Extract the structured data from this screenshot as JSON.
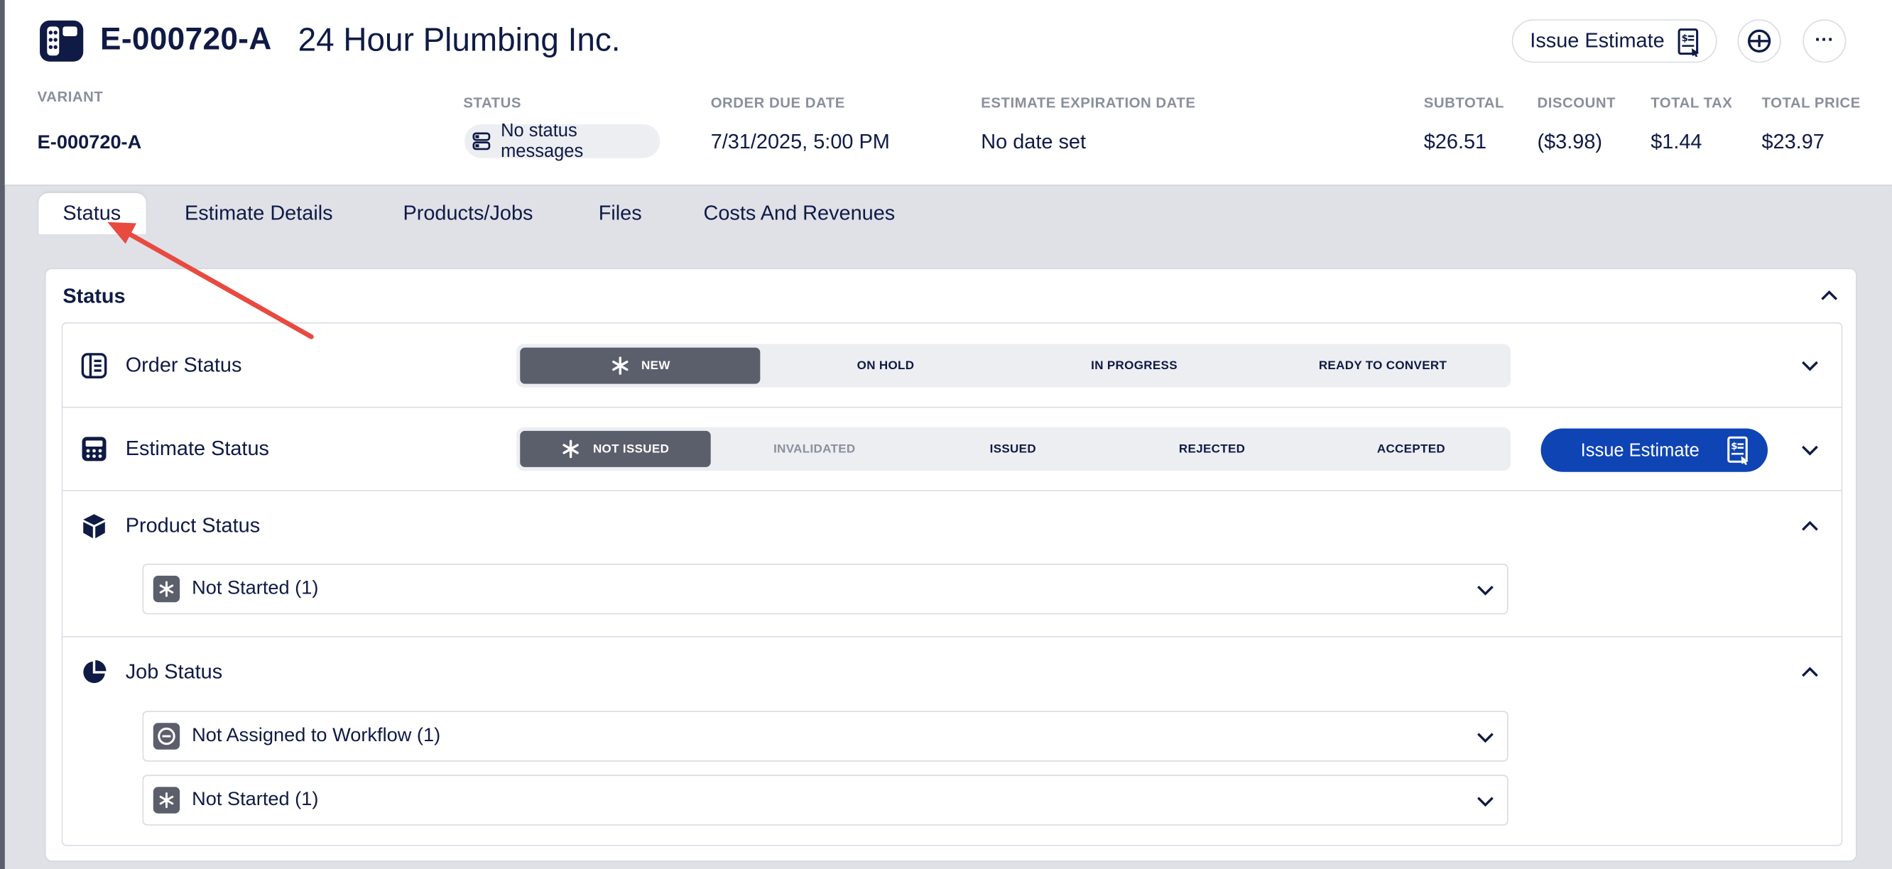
{
  "header": {
    "estimate_id": "E-000720-A",
    "company": "24 Hour Plumbing Inc.",
    "issue_button": "Issue Estimate",
    "more": "···"
  },
  "meta": {
    "variant_label": "VARIANT",
    "variant_value": "E-000720-A",
    "status_label": "STATUS",
    "status_value": "No status messages",
    "due_label": "ORDER DUE DATE",
    "due_value": "7/31/2025, 5:00 PM",
    "exp_label": "ESTIMATE EXPIRATION DATE",
    "exp_value": "No date set",
    "subtotal_label": "SUBTOTAL",
    "subtotal_value": "$26.51",
    "discount_label": "DISCOUNT",
    "discount_value": "($3.98)",
    "tax_label": "TOTAL TAX",
    "tax_value": "$1.44",
    "total_label": "TOTAL PRICE",
    "total_value": "$23.97"
  },
  "tabs": [
    "Status",
    "Estimate Details",
    "Products/Jobs",
    "Files",
    "Costs And Revenues"
  ],
  "panel": {
    "title": "Status",
    "order_status": {
      "label": "Order Status",
      "options": [
        "NEW",
        "ON HOLD",
        "IN PROGRESS",
        "READY TO CONVERT"
      ],
      "active": "NEW"
    },
    "estimate_status": {
      "label": "Estimate Status",
      "options": [
        "NOT ISSUED",
        "INVALIDATED",
        "ISSUED",
        "REJECTED",
        "ACCEPTED"
      ],
      "active": "NOT ISSUED",
      "button": "Issue Estimate"
    },
    "product_status": {
      "label": "Product Status",
      "items": [
        "Not Started (1)"
      ]
    },
    "job_status": {
      "label": "Job Status",
      "items": [
        "Not Assigned to Workflow (1)",
        "Not Started (1)"
      ]
    }
  },
  "colors": {
    "primary": "#0f44b5",
    "navy": "#0f1a45",
    "active_segment": "#5b5e6b",
    "annotation_arrow": "#e84a3f"
  }
}
